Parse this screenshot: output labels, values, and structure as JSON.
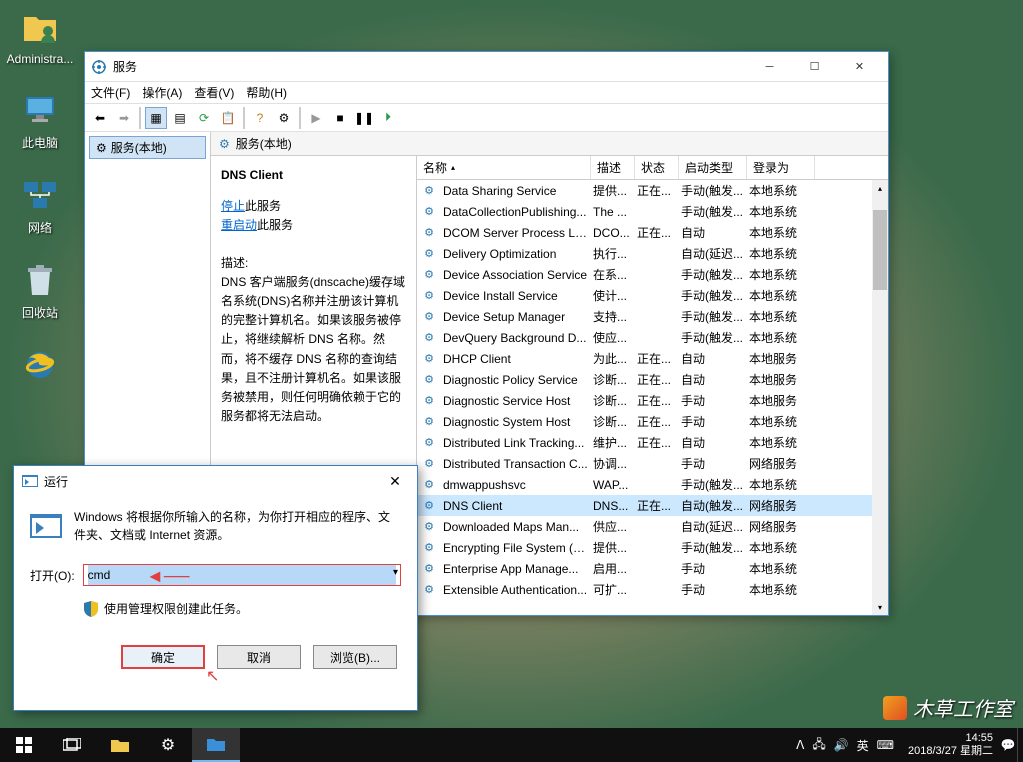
{
  "desktop_icons": [
    "Administra...",
    "此电脑",
    "网络",
    "回收站",
    ""
  ],
  "services_window": {
    "title": "服务",
    "menu": [
      "文件(F)",
      "操作(A)",
      "查看(V)",
      "帮助(H)"
    ],
    "left_panel_item": "服务(本地)",
    "right_header": "服务(本地)",
    "detail": {
      "name": "DNS Client",
      "stop_link": "停止",
      "stop_suffix": "此服务",
      "restart_link": "重启动",
      "restart_suffix": "此服务",
      "desc_label": "描述:",
      "desc_text": "DNS 客户端服务(dnscache)缓存域名系统(DNS)名称并注册该计算机的完整计算机名。如果该服务被停止，将继续解析 DNS 名称。然而，将不缓存 DNS 名称的查询结果，且不注册计算机名。如果该服务被禁用，则任何明确依赖于它的服务都将无法启动。"
    },
    "columns": [
      "名称",
      "描述",
      "状态",
      "启动类型",
      "登录为"
    ],
    "rows": [
      {
        "name": "Data Sharing Service",
        "desc": "提供...",
        "status": "正在...",
        "startup": "手动(触发...",
        "logon": "本地系统"
      },
      {
        "name": "DataCollectionPublishing...",
        "desc": "The ...",
        "status": "",
        "startup": "手动(触发...",
        "logon": "本地系统"
      },
      {
        "name": "DCOM Server Process La...",
        "desc": "DCO...",
        "status": "正在...",
        "startup": "自动",
        "logon": "本地系统"
      },
      {
        "name": "Delivery Optimization",
        "desc": "执行...",
        "status": "",
        "startup": "自动(延迟...",
        "logon": "本地系统"
      },
      {
        "name": "Device Association Service",
        "desc": "在系...",
        "status": "",
        "startup": "手动(触发...",
        "logon": "本地系统"
      },
      {
        "name": "Device Install Service",
        "desc": "使计...",
        "status": "",
        "startup": "手动(触发...",
        "logon": "本地系统"
      },
      {
        "name": "Device Setup Manager",
        "desc": "支持...",
        "status": "",
        "startup": "手动(触发...",
        "logon": "本地系统"
      },
      {
        "name": "DevQuery Background D...",
        "desc": "使应...",
        "status": "",
        "startup": "手动(触发...",
        "logon": "本地系统"
      },
      {
        "name": "DHCP Client",
        "desc": "为此...",
        "status": "正在...",
        "startup": "自动",
        "logon": "本地服务"
      },
      {
        "name": "Diagnostic Policy Service",
        "desc": "诊断...",
        "status": "正在...",
        "startup": "自动",
        "logon": "本地服务"
      },
      {
        "name": "Diagnostic Service Host",
        "desc": "诊断...",
        "status": "正在...",
        "startup": "手动",
        "logon": "本地服务"
      },
      {
        "name": "Diagnostic System Host",
        "desc": "诊断...",
        "status": "正在...",
        "startup": "手动",
        "logon": "本地系统"
      },
      {
        "name": "Distributed Link Tracking...",
        "desc": "维护...",
        "status": "正在...",
        "startup": "自动",
        "logon": "本地系统"
      },
      {
        "name": "Distributed Transaction C...",
        "desc": "协调...",
        "status": "",
        "startup": "手动",
        "logon": "网络服务"
      },
      {
        "name": "dmwappushsvc",
        "desc": "WAP...",
        "status": "",
        "startup": "手动(触发...",
        "logon": "本地系统"
      },
      {
        "name": "DNS Client",
        "desc": "DNS...",
        "status": "正在...",
        "startup": "自动(触发...",
        "logon": "网络服务",
        "selected": true
      },
      {
        "name": "Downloaded Maps Man...",
        "desc": "供应...",
        "status": "",
        "startup": "自动(延迟...",
        "logon": "网络服务"
      },
      {
        "name": "Encrypting File System (E...",
        "desc": "提供...",
        "status": "",
        "startup": "手动(触发...",
        "logon": "本地系统"
      },
      {
        "name": "Enterprise App Manage...",
        "desc": "启用...",
        "status": "",
        "startup": "手动",
        "logon": "本地系统"
      },
      {
        "name": "Extensible Authentication...",
        "desc": "可扩...",
        "status": "",
        "startup": "手动",
        "logon": "本地系统"
      }
    ]
  },
  "run_dialog": {
    "title": "运行",
    "desc": "Windows 将根据你所输入的名称，为你打开相应的程序、文件夹、文档或 Internet 资源。",
    "open_label": "打开(O):",
    "input_value": "cmd",
    "shield_text": "使用管理权限创建此任务。",
    "ok": "确定",
    "cancel": "取消",
    "browse": "浏览(B)..."
  },
  "watermark": "木草工作室",
  "taskbar": {
    "ime": "英",
    "time": "14:55",
    "date": "2018/3/27 星期二"
  }
}
